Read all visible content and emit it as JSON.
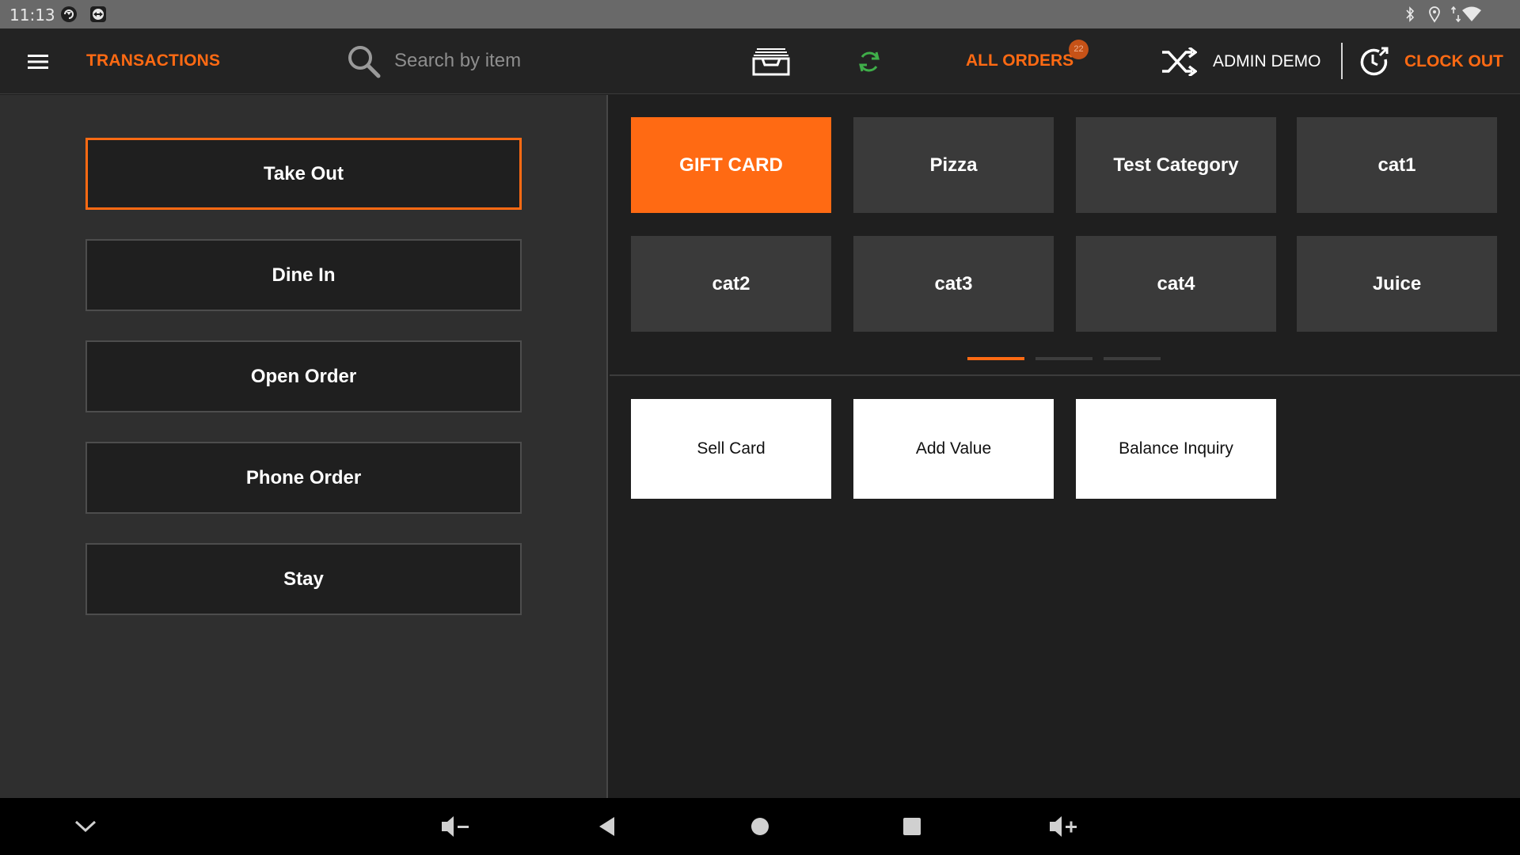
{
  "status_bar": {
    "time": "11:13"
  },
  "app_bar": {
    "title": "TRANSACTIONS",
    "search_placeholder": "Search by item",
    "all_orders_label": "ALL ORDERS",
    "orders_badge_count": "22",
    "user_label": "ADMIN DEMO",
    "clock_out_label": "CLOCK OUT"
  },
  "order_types": [
    {
      "label": "Take Out",
      "selected": true
    },
    {
      "label": "Dine In",
      "selected": false
    },
    {
      "label": "Open Order",
      "selected": false
    },
    {
      "label": "Phone Order",
      "selected": false
    },
    {
      "label": "Stay",
      "selected": false
    }
  ],
  "categories": [
    {
      "label": "GIFT CARD",
      "selected": true
    },
    {
      "label": "Pizza",
      "selected": false
    },
    {
      "label": "Test Category",
      "selected": false
    },
    {
      "label": "cat1",
      "selected": false
    },
    {
      "label": "cat2",
      "selected": false
    },
    {
      "label": "cat3",
      "selected": false
    },
    {
      "label": "cat4",
      "selected": false
    },
    {
      "label": "Juice",
      "selected": false
    }
  ],
  "category_pager": {
    "pages": 3,
    "current_page": 1
  },
  "gift_card_actions": [
    {
      "label": "Sell Card"
    },
    {
      "label": "Add Value"
    },
    {
      "label": "Balance Inquiry"
    }
  ],
  "colors": {
    "accent": "#ff6a13",
    "panel_left": "#2f2f2f",
    "panel_right": "#1f1f1f",
    "tile": "#3a3a3a",
    "sync_green": "#3fae49"
  },
  "icons": {
    "status_left": [
      "app-circle-icon",
      "teamviewer-icon"
    ],
    "status_right": [
      "bluetooth-icon",
      "location-icon",
      "data-arrows-icon",
      "wifi-icon"
    ],
    "app_bar": [
      "menu-icon",
      "search-icon",
      "cash-drawer-icon",
      "sync-icon",
      "shuffle-icon",
      "clock-out-icon"
    ],
    "nav_bar": [
      "chevron-down-icon",
      "volume-down-icon",
      "back-icon",
      "home-icon",
      "recents-icon",
      "volume-up-icon"
    ]
  }
}
